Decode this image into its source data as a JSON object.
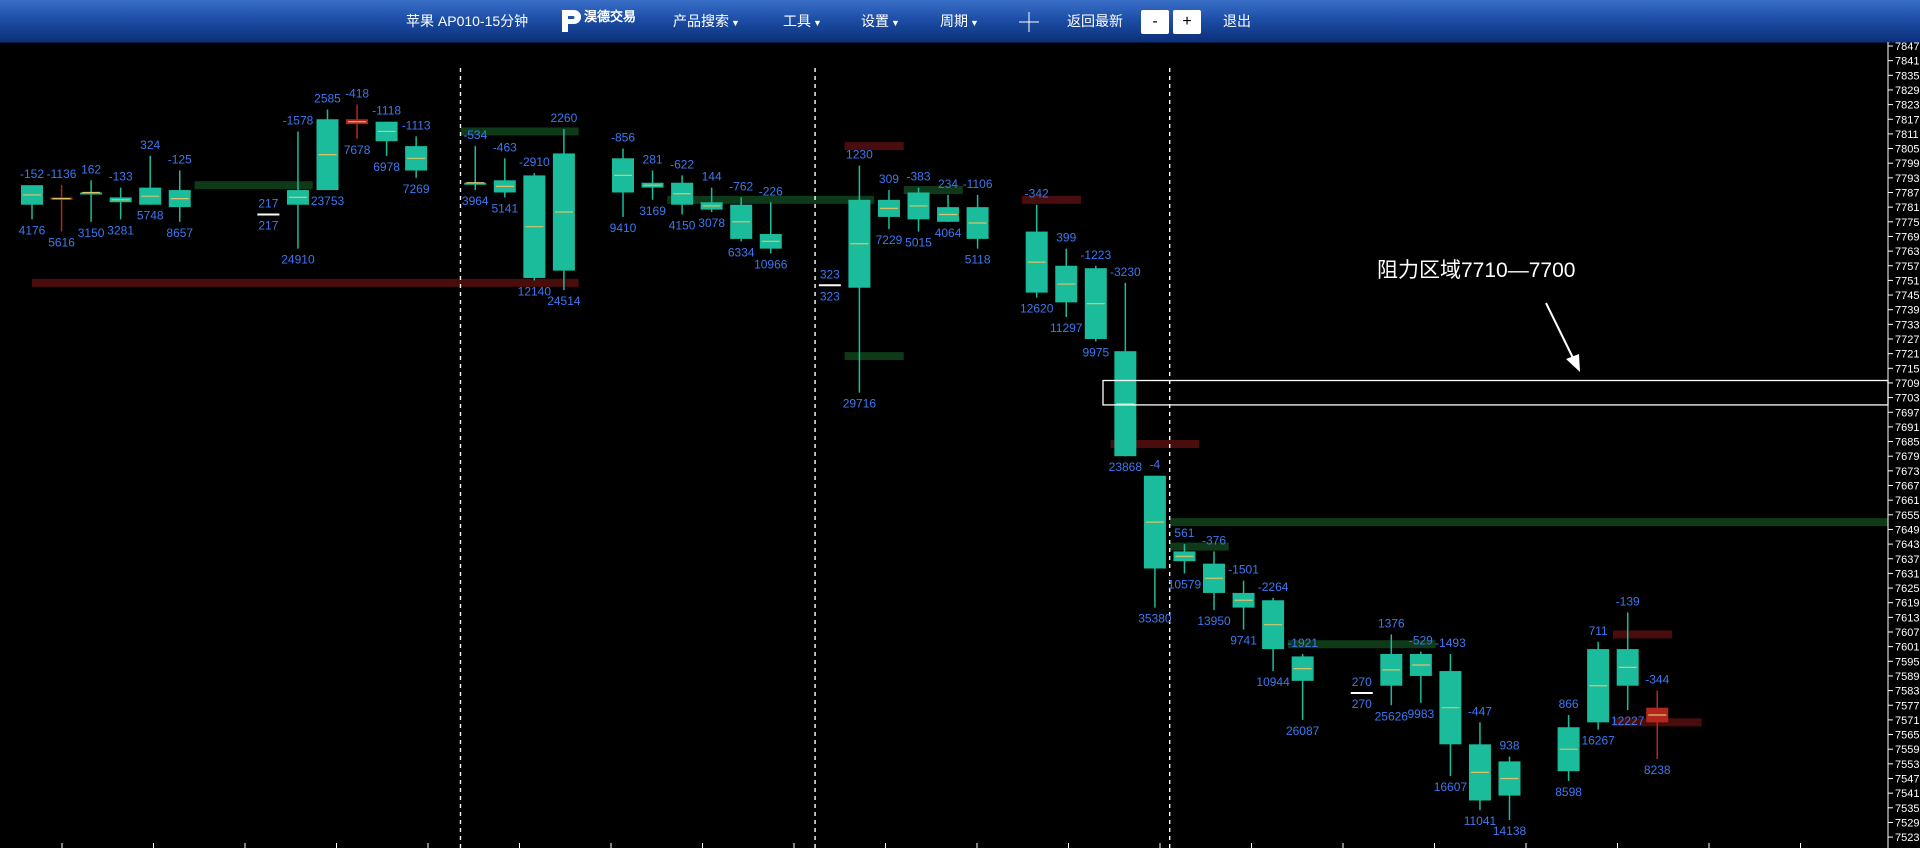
{
  "nav": {
    "symbol_label": "苹果 AP010-15分钟",
    "logo_text": "淏德交易",
    "logo_sub": "",
    "product_search": "产品搜索",
    "tools": "工具",
    "settings": "设置",
    "period": "周期",
    "crosshair_icon": "crosshair-icon",
    "back_latest": "返回最新",
    "zoom_out": "-",
    "zoom_in": "+",
    "exit": "退出"
  },
  "colors": {
    "up": "#1abc9c",
    "down": "#b3261e",
    "label": "#3d78f0",
    "axis": "#ffffff",
    "zone_red": "#4a0d0d",
    "zone_green": "#0f3a1a"
  },
  "chart_data": {
    "type": "candlestick",
    "title": "",
    "ylim": [
      7521,
      7848
    ],
    "y_ticks": [
      7847,
      7841,
      7835,
      7829,
      7823,
      7817,
      7811,
      7805,
      7799,
      7793,
      7787,
      7781,
      7775,
      7769,
      7763,
      7757,
      7751,
      7745,
      7739,
      7733,
      7727,
      7721,
      7715,
      7709,
      7703,
      7697,
      7691,
      7685,
      7679,
      7673,
      7667,
      7661,
      7655,
      7649,
      7643,
      7637,
      7631,
      7625,
      7619,
      7613,
      7607,
      7601,
      7595,
      7589,
      7583,
      7577,
      7571,
      7565,
      7559,
      7553,
      7547,
      7541,
      7535,
      7529,
      7523
    ],
    "annotation": {
      "text": "阻力区域7710—7700",
      "zone_low": 7700,
      "zone_high": 7710
    },
    "session_separators": [
      14.5,
      26.5,
      38.5
    ],
    "zones": [
      {
        "color": "red",
        "y": 7750,
        "from": 0,
        "to": 18.5
      },
      {
        "color": "green",
        "y": 7790,
        "from": 5.5,
        "to": 9.5
      },
      {
        "color": "green",
        "y": 7812,
        "from": 14.5,
        "to": 18.5
      },
      {
        "color": "green",
        "y": 7784,
        "from": 21.5,
        "to": 28.5
      },
      {
        "color": "red",
        "y": 7806,
        "from": 27.5,
        "to": 29.5
      },
      {
        "color": "green",
        "y": 7720,
        "from": 27.5,
        "to": 29.5
      },
      {
        "color": "green",
        "y": 7788,
        "from": 29.5,
        "to": 31.5
      },
      {
        "color": "red",
        "y": 7784,
        "from": 33.5,
        "to": 35.5
      },
      {
        "color": "red",
        "y": 7684,
        "from": 36.5,
        "to": 39.5
      },
      {
        "color": "green",
        "y": 7652,
        "from": 38.5,
        "to": 62.5
      },
      {
        "color": "green",
        "y": 7642,
        "from": 38.5,
        "to": 40.5
      },
      {
        "color": "green",
        "y": 7602,
        "from": 42.5,
        "to": 47.5
      },
      {
        "color": "red",
        "y": 7606,
        "from": 53.5,
        "to": 55.5
      },
      {
        "color": "red",
        "y": 7570,
        "from": 53.5,
        "to": 56.5
      }
    ],
    "candles": [
      {
        "i": 0,
        "o": 7782,
        "h": 7790,
        "l": 7776,
        "c": 7790,
        "top": "-152",
        "bot": "4176"
      },
      {
        "i": 1,
        "o": 7785,
        "h": 7790,
        "l": 7771,
        "c": 7784,
        "top": "-1136",
        "bot": "5616"
      },
      {
        "i": 2,
        "o": 7787,
        "h": 7792,
        "l": 7775,
        "c": 7787,
        "top": "162",
        "bot": "3150"
      },
      {
        "i": 3,
        "o": 7783,
        "h": 7789,
        "l": 7776,
        "c": 7785,
        "top": "-133",
        "bot": "3281"
      },
      {
        "i": 4,
        "o": 7782,
        "h": 7802,
        "l": 7782,
        "c": 7789,
        "top": "324",
        "bot": "5748"
      },
      {
        "i": 5,
        "o": 7781,
        "h": 7796,
        "l": 7775,
        "c": 7788,
        "top": "-125",
        "bot": "8657"
      },
      {
        "i": 8,
        "o": 7778,
        "h": 7778,
        "l": 7778,
        "c": 7778,
        "top": "217",
        "bot": "217"
      },
      {
        "i": 9,
        "o": 7782,
        "h": 7812,
        "l": 7764,
        "c": 7788,
        "top": "-1578",
        "bot": "24910"
      },
      {
        "i": 10,
        "o": 7788,
        "h": 7821,
        "l": 7788,
        "c": 7817,
        "top": "2585",
        "bot": "23753"
      },
      {
        "i": 11,
        "o": 7817,
        "h": 7823,
        "l": 7809,
        "c": 7815,
        "top": "-418",
        "bot": "7678"
      },
      {
        "i": 12,
        "o": 7808,
        "h": 7816,
        "l": 7802,
        "c": 7816,
        "top": "-1118",
        "bot": "6978"
      },
      {
        "i": 13,
        "o": 7796,
        "h": 7810,
        "l": 7793,
        "c": 7806,
        "top": "-1113",
        "bot": "7269"
      },
      {
        "i": 15,
        "o": 7791,
        "h": 7806,
        "l": 7788,
        "c": 7791,
        "top": "-534",
        "bot": "3964"
      },
      {
        "i": 16,
        "o": 7787,
        "h": 7801,
        "l": 7785,
        "c": 7792,
        "top": "-463",
        "bot": "5141"
      },
      {
        "i": 17,
        "o": 7752,
        "h": 7795,
        "l": 7751,
        "c": 7794,
        "top": "-2910",
        "bot": "12140"
      },
      {
        "i": 18,
        "o": 7755,
        "h": 7813,
        "l": 7747,
        "c": 7803,
        "top": "2260",
        "bot": "24514"
      },
      {
        "i": 20,
        "o": 7787,
        "h": 7805,
        "l": 7777,
        "c": 7801,
        "top": "-856",
        "bot": "9410"
      },
      {
        "i": 21,
        "o": 7789,
        "h": 7796,
        "l": 7784,
        "c": 7791,
        "top": "281",
        "bot": "3169"
      },
      {
        "i": 22,
        "o": 7782,
        "h": 7794,
        "l": 7778,
        "c": 7791,
        "top": "-622",
        "bot": "4150"
      },
      {
        "i": 23,
        "o": 7780,
        "h": 7789,
        "l": 7779,
        "c": 7783,
        "top": "144",
        "bot": "3078"
      },
      {
        "i": 24,
        "o": 7768,
        "h": 7785,
        "l": 7767,
        "c": 7782,
        "top": "-762",
        "bot": "6334"
      },
      {
        "i": 25,
        "o": 7764,
        "h": 7783,
        "l": 7762,
        "c": 7770,
        "top": "-226",
        "bot": "10966"
      },
      {
        "i": 27,
        "o": 7749,
        "h": 7749,
        "l": 7749,
        "c": 7749,
        "top": "323",
        "bot": "323"
      },
      {
        "i": 28,
        "o": 7748,
        "h": 7798,
        "l": 7705,
        "c": 7784,
        "top": "1230",
        "bot": "29716"
      },
      {
        "i": 29,
        "o": 7777,
        "h": 7788,
        "l": 7772,
        "c": 7784,
        "top": "309",
        "bot": "7229"
      },
      {
        "i": 30,
        "o": 7776,
        "h": 7789,
        "l": 7771,
        "c": 7787,
        "top": "-383",
        "bot": "5015"
      },
      {
        "i": 31,
        "o": 7775,
        "h": 7786,
        "l": 7775,
        "c": 7781,
        "top": "234",
        "bot": "4064"
      },
      {
        "i": 32,
        "o": 7768,
        "h": 7786,
        "l": 7764,
        "c": 7781,
        "top": "-1106",
        "bot": "5118"
      },
      {
        "i": 34,
        "o": 7746,
        "h": 7782,
        "l": 7744,
        "c": 7771,
        "top": "-342",
        "bot": "12620"
      },
      {
        "i": 35,
        "o": 7742,
        "h": 7764,
        "l": 7736,
        "c": 7757,
        "top": "399",
        "bot": "11297"
      },
      {
        "i": 36,
        "o": 7727,
        "h": 7757,
        "l": 7726,
        "c": 7756,
        "top": "-1223",
        "bot": "9975"
      },
      {
        "i": 37,
        "o": 7679,
        "h": 7750,
        "l": 7679,
        "c": 7722,
        "top": "-3230",
        "bot": "23868"
      },
      {
        "i": 38,
        "o": 7633,
        "h": 7671,
        "l": 7617,
        "c": 7671,
        "top": "-4",
        "bot": "35380"
      },
      {
        "i": 39,
        "o": 7636,
        "h": 7643,
        "l": 7631,
        "c": 7640,
        "top": "561",
        "bot": "10579"
      },
      {
        "i": 40,
        "o": 7623,
        "h": 7640,
        "l": 7616,
        "c": 7635,
        "top": "-376",
        "bot": "13950"
      },
      {
        "i": 41,
        "o": 7617,
        "h": 7628,
        "l": 7608,
        "c": 7623,
        "top": "-1501",
        "bot": "9741"
      },
      {
        "i": 42,
        "o": 7600,
        "h": 7621,
        "l": 7591,
        "c": 7620,
        "top": "-2264",
        "bot": "10944"
      },
      {
        "i": 43,
        "o": 7587,
        "h": 7598,
        "l": 7571,
        "c": 7597,
        "top": "-1921",
        "bot": "26087"
      },
      {
        "i": 45,
        "o": 7582,
        "h": 7582,
        "l": 7582,
        "c": 7582,
        "top": "270",
        "bot": "270"
      },
      {
        "i": 46,
        "o": 7585,
        "h": 7606,
        "l": 7577,
        "c": 7598,
        "top": "1376",
        "bot": "25626"
      },
      {
        "i": 47,
        "o": 7589,
        "h": 7599,
        "l": 7578,
        "c": 7598,
        "top": "-529",
        "bot": "9983"
      },
      {
        "i": 48,
        "o": 7561,
        "h": 7598,
        "l": 7548,
        "c": 7591,
        "top": "-1493",
        "bot": "16607"
      },
      {
        "i": 49,
        "o": 7538,
        "h": 7570,
        "l": 7534,
        "c": 7561,
        "top": "-447",
        "bot": "11041"
      },
      {
        "i": 50,
        "o": 7540,
        "h": 7556,
        "l": 7530,
        "c": 7554,
        "top": "938",
        "bot": "14138"
      },
      {
        "i": 52,
        "o": 7550,
        "h": 7573,
        "l": 7546,
        "c": 7568,
        "top": "866",
        "bot": "8598"
      },
      {
        "i": 53,
        "o": 7570,
        "h": 7603,
        "l": 7567,
        "c": 7600,
        "top": "711",
        "bot": "16267"
      },
      {
        "i": 54,
        "o": 7585,
        "h": 7615,
        "l": 7575,
        "c": 7600,
        "top": "-139",
        "bot": "12227"
      },
      {
        "i": 55,
        "o": 7576,
        "h": 7583,
        "l": 7555,
        "c": 7570,
        "top": "-344",
        "bot": "8238"
      }
    ]
  }
}
